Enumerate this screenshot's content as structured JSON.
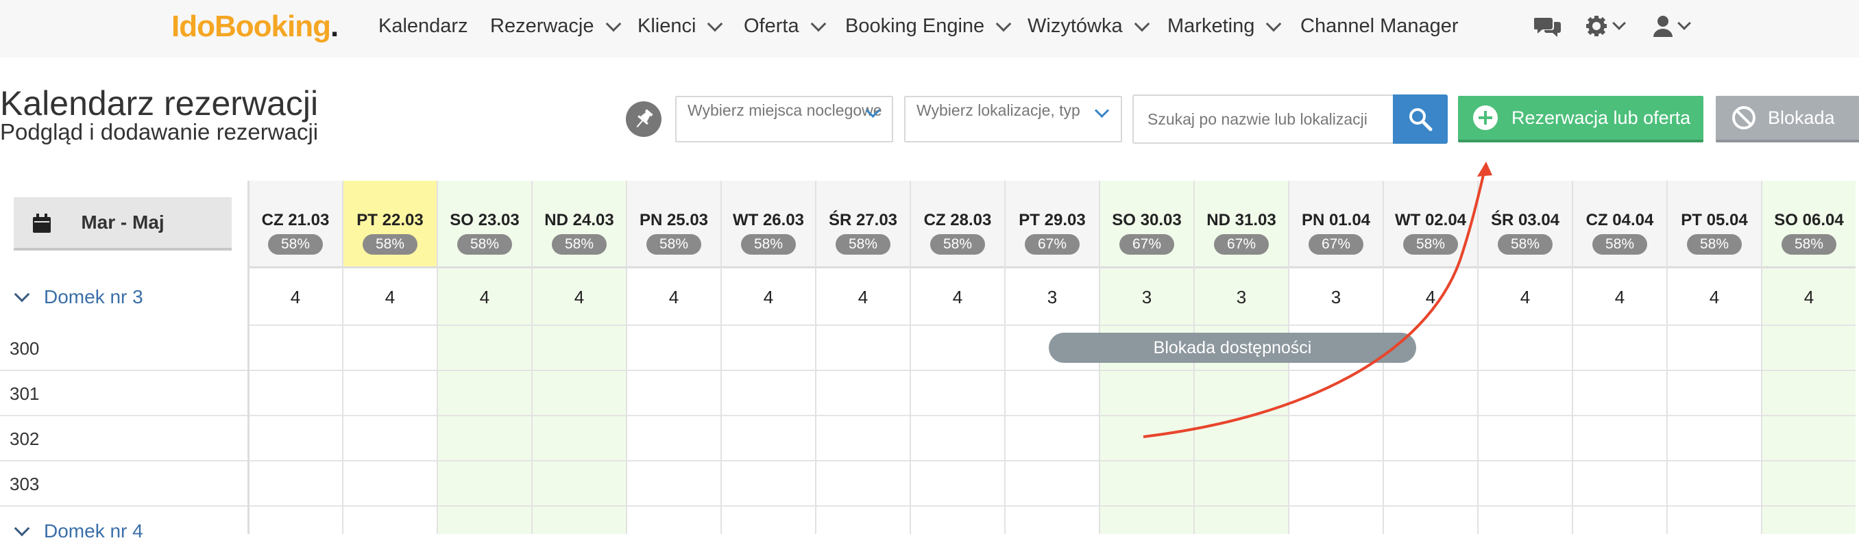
{
  "logo": {
    "part1": "Ido",
    "part2": "Booking",
    "dot": "."
  },
  "nav": {
    "items": [
      {
        "label": "Kalendarz",
        "dropdown": false
      },
      {
        "label": "Rezerwacje",
        "dropdown": true
      },
      {
        "label": "Klienci",
        "dropdown": true
      },
      {
        "label": "Oferta",
        "dropdown": true
      },
      {
        "label": "Booking Engine",
        "dropdown": true
      },
      {
        "label": "Wizytówka",
        "dropdown": true
      },
      {
        "label": "Marketing",
        "dropdown": true
      },
      {
        "label": "Channel Manager",
        "dropdown": false
      }
    ],
    "icons": [
      "chat-icon",
      "gear-icon",
      "user-icon"
    ]
  },
  "header": {
    "title": "Kalendarz rezerwacji",
    "subtitle": "Podgląd i dodawanie rezerwacji",
    "select_places_placeholder": "Wybierz miejsca noclegowe",
    "select_location_placeholder": "Wybierz lokalizacje, typ",
    "search_placeholder": "Szukaj po nazwie lub lokalizacji",
    "add_button": "Rezerwacja lub oferta",
    "block_button": "Blokada"
  },
  "calendar": {
    "range_label": "Mar - Maj",
    "days": [
      {
        "label": "CZ 21.03",
        "pct": "58%",
        "avail": "4",
        "weekend": false,
        "today": false
      },
      {
        "label": "PT 22.03",
        "pct": "58%",
        "avail": "4",
        "weekend": false,
        "today": true
      },
      {
        "label": "SO 23.03",
        "pct": "58%",
        "avail": "4",
        "weekend": true,
        "today": false
      },
      {
        "label": "ND 24.03",
        "pct": "58%",
        "avail": "4",
        "weekend": true,
        "today": false
      },
      {
        "label": "PN 25.03",
        "pct": "58%",
        "avail": "4",
        "weekend": false,
        "today": false
      },
      {
        "label": "WT 26.03",
        "pct": "58%",
        "avail": "4",
        "weekend": false,
        "today": false
      },
      {
        "label": "ŚR 27.03",
        "pct": "58%",
        "avail": "4",
        "weekend": false,
        "today": false
      },
      {
        "label": "CZ 28.03",
        "pct": "58%",
        "avail": "4",
        "weekend": false,
        "today": false
      },
      {
        "label": "PT 29.03",
        "pct": "67%",
        "avail": "3",
        "weekend": false,
        "today": false
      },
      {
        "label": "SO 30.03",
        "pct": "67%",
        "avail": "3",
        "weekend": true,
        "today": false
      },
      {
        "label": "ND 31.03",
        "pct": "67%",
        "avail": "3",
        "weekend": true,
        "today": false
      },
      {
        "label": "PN 01.04",
        "pct": "67%",
        "avail": "3",
        "weekend": false,
        "today": false
      },
      {
        "label": "WT 02.04",
        "pct": "58%",
        "avail": "4",
        "weekend": false,
        "today": false
      },
      {
        "label": "ŚR 03.04",
        "pct": "58%",
        "avail": "4",
        "weekend": false,
        "today": false
      },
      {
        "label": "CZ 04.04",
        "pct": "58%",
        "avail": "4",
        "weekend": false,
        "today": false
      },
      {
        "label": "PT 05.04",
        "pct": "58%",
        "avail": "4",
        "weekend": false,
        "today": false
      },
      {
        "label": "SO 06.04",
        "pct": "58%",
        "avail": "4",
        "weekend": true,
        "today": false
      }
    ],
    "groups": [
      {
        "name": "Domek nr 3",
        "rooms": [
          "300",
          "301",
          "302",
          "303"
        ]
      },
      {
        "name": "Domek nr 4",
        "rooms": []
      }
    ],
    "block_bar_label": "Blokada dostępności"
  }
}
